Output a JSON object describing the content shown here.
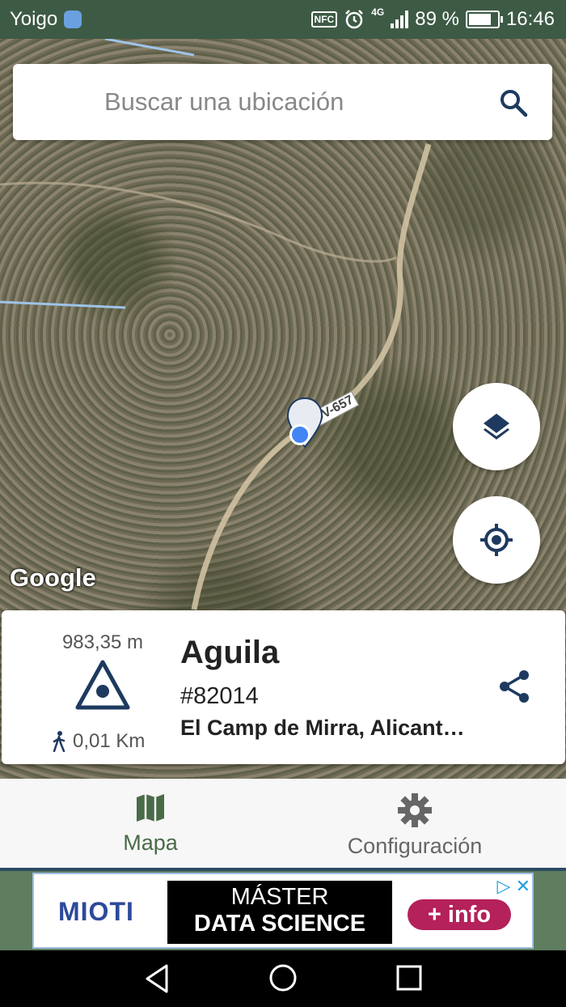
{
  "status_bar": {
    "carrier": "Yoigo",
    "nfc": "NFC",
    "network": "4G",
    "battery": "89 %",
    "battery_level": 0.89,
    "time": "16:46"
  },
  "search": {
    "placeholder": "Buscar una ubicación"
  },
  "map": {
    "road_label": "CV-657",
    "attribution": "Google"
  },
  "peak": {
    "elevation": "983,35 m",
    "distance": "0,01 Km",
    "name": "Aguila",
    "id": "#82014",
    "location": "El Camp de Mirra, Alicant…"
  },
  "nav": {
    "items": [
      {
        "label": "Mapa",
        "active": true
      },
      {
        "label": "Configuración",
        "active": false
      }
    ]
  },
  "ad": {
    "brand": "MIOTI",
    "line1": "MÁSTER",
    "line2": "DATA SCIENCE",
    "cta": "+ info"
  },
  "colors": {
    "status_bar": "#3d5a45",
    "accent": "#1e3a5f",
    "nav_active": "#4a6b48",
    "nav_inactive": "#666666",
    "location_dot": "#4285f4",
    "ad_cta": "#b5215a"
  }
}
